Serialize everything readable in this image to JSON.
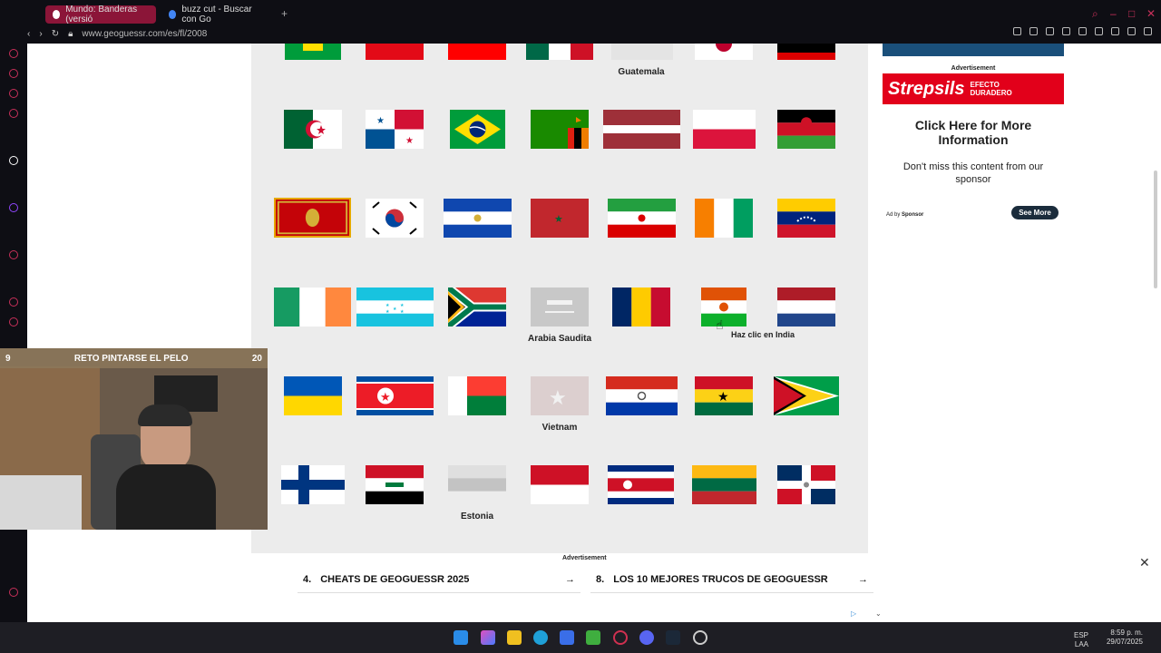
{
  "browser": {
    "tabs": [
      {
        "label": "Mundo: Banderas (versió"
      },
      {
        "label": "buzz cut - Buscar con Go"
      }
    ],
    "url": "www.geoguessr.com/es/fl/2008"
  },
  "grid": {
    "labels": {
      "guatemala": "Guatemala",
      "arabia": "Arabia Saudita",
      "vietnam": "Vietnam",
      "estonia": "Estonia"
    },
    "tooltip": "Haz clic en India"
  },
  "right_ad": {
    "advertisement": "Advertisement",
    "brand": "Strepsils",
    "badge": "EFECTO DURADERO",
    "headline": "Click Here for More Information",
    "body": "Don't miss this content from our sponsor",
    "adby": "Ad by",
    "sponsor": "Sponsor",
    "cta": "See More"
  },
  "webcam": {
    "left_num": "9",
    "title": "RETO PINTARSE EL PELO",
    "right_num": "20"
  },
  "bottom_ad": {
    "advertisement": "Advertisement",
    "card1_num": "4.",
    "card1_text": "CHEATS DE GEOGUESSR 2025",
    "card2_num": "8.",
    "card2_text": "LOS 10 MEJORES TRUCOS DE GEOGUESSR"
  },
  "taskbar": {
    "lang1": "ESP",
    "lang2": "LAA",
    "time": "8:59 p. m.",
    "date": "29/07/2025"
  }
}
